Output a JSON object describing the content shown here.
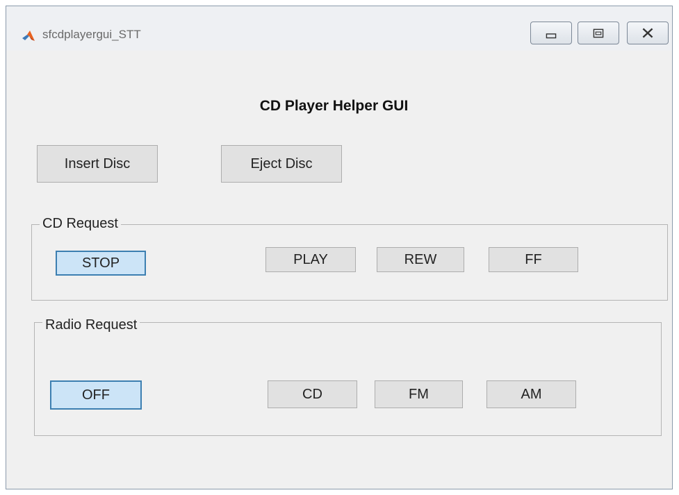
{
  "window": {
    "title": "sfcdplayergui_STT",
    "controls": {
      "minimize": "minimize-icon",
      "maximize": "restore-icon",
      "close": "close-icon"
    }
  },
  "gui_title": "CD Player Helper GUI",
  "disc_buttons": {
    "insert_label": "Insert Disc",
    "eject_label": "Eject Disc"
  },
  "cd_request": {
    "label": "CD Request",
    "buttons": [
      "STOP",
      "PLAY",
      "REW",
      "FF"
    ],
    "selected": "STOP"
  },
  "radio_request": {
    "label": "Radio Request",
    "buttons": [
      "OFF",
      "CD",
      "FM",
      "AM"
    ],
    "selected": "OFF"
  },
  "colors": {
    "background": "#f0f0f0",
    "button": "#e1e1e1",
    "selected_fill": "#cce4f7",
    "selected_border": "#3c7fb1"
  }
}
